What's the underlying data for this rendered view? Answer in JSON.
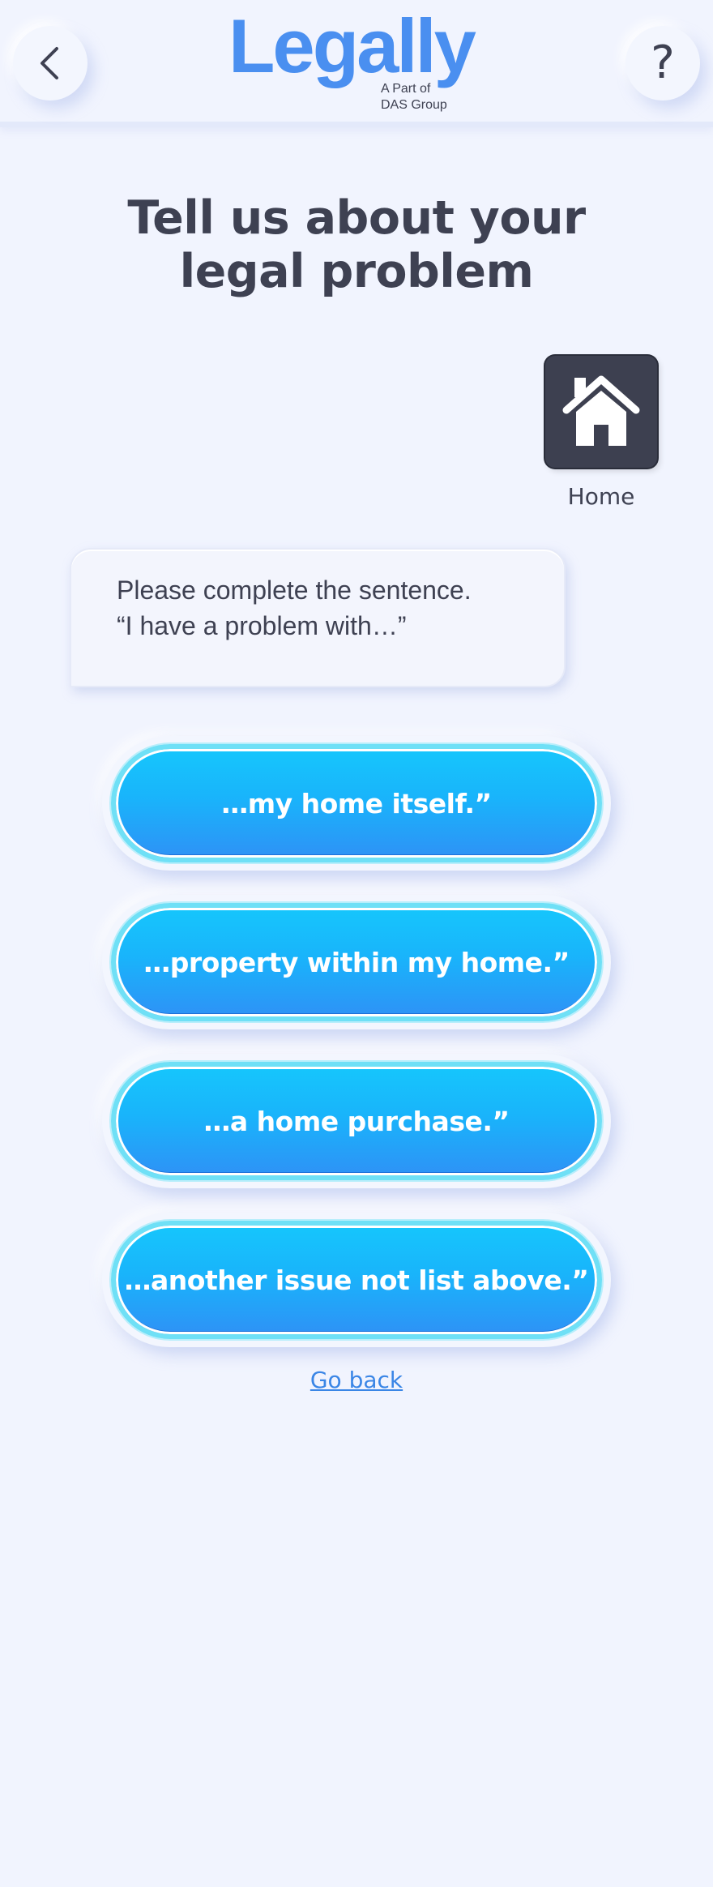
{
  "header": {
    "logo": {
      "word": "Legally",
      "tagline_line1": "A Part of",
      "tagline_line2": "DAS Group"
    },
    "back_icon": "chevron-left-icon",
    "help_label": "?"
  },
  "page": {
    "title_line1": "Tell us about your",
    "title_line2": "legal problem"
  },
  "category": {
    "icon": "house-icon",
    "label": "Home"
  },
  "prompt": {
    "line1": "Please complete the sentence.",
    "line2": "“I have a problem with…”"
  },
  "options": [
    {
      "label": "…my home itself.”"
    },
    {
      "label": "…property within my home.”"
    },
    {
      "label": "…a home purchase.”"
    },
    {
      "label": "…another issue not list above.”"
    }
  ],
  "footer": {
    "go_back_label": "Go back"
  },
  "colors": {
    "background": "#f1f4fe",
    "button_top": "#16c6fc",
    "button_bottom": "#2e92f6",
    "link": "#3a86e6",
    "text": "#3e4152"
  }
}
